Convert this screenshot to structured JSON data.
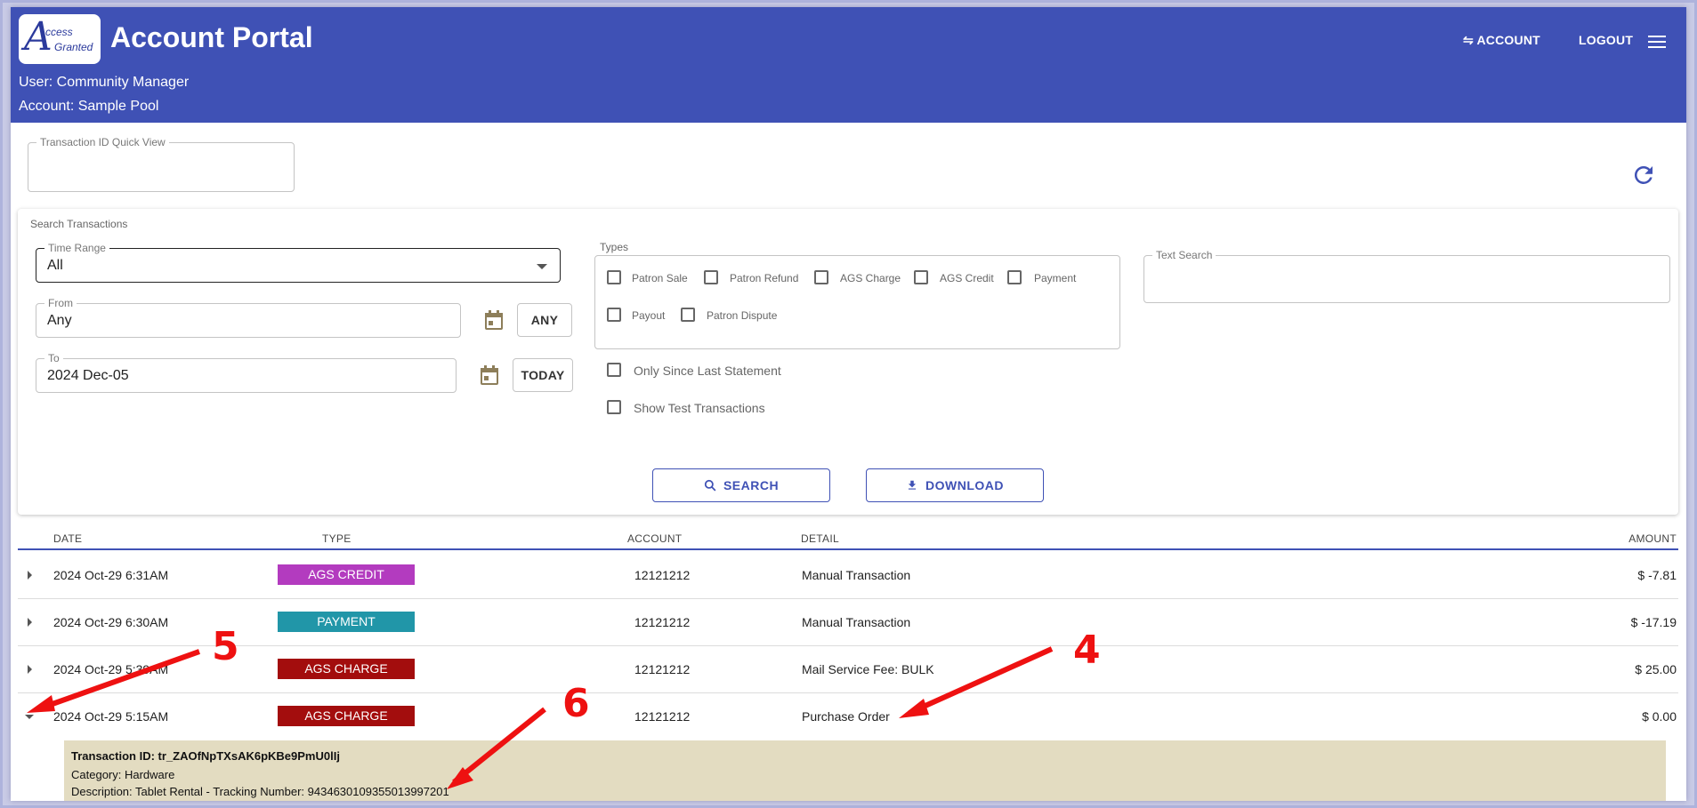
{
  "header": {
    "logo_letter": "A",
    "logo_line1": "ccess",
    "logo_line2": "Granted",
    "title": "Account Portal",
    "user_line": "User: Community Manager",
    "account_line": "Account: Sample Pool",
    "account_button": "⇋ ACCOUNT",
    "logout_button": "LOGOUT"
  },
  "quick_view": {
    "label": "Transaction ID Quick View",
    "value": ""
  },
  "search": {
    "section_label": "Search Transactions",
    "time_range_label": "Time Range",
    "time_range_value": "All",
    "from_label": "From",
    "from_value": "Any",
    "any_button": "ANY",
    "to_label": "To",
    "to_value": "2024 Dec-05",
    "today_button": "TODAY",
    "types_label": "Types",
    "types": [
      "Patron Sale",
      "Patron Refund",
      "AGS Charge",
      "AGS Credit",
      "Payment",
      "Payout",
      "Patron Dispute"
    ],
    "only_since_label": "Only Since Last Statement",
    "show_test_label": "Show Test Transactions",
    "text_search_label": "Text Search",
    "text_search_value": "",
    "search_button": "SEARCH",
    "download_button": "DOWNLOAD"
  },
  "table": {
    "headers": {
      "date": "DATE",
      "type": "TYPE",
      "account": "ACCOUNT",
      "detail": "DETAIL",
      "amount": "AMOUNT"
    },
    "rows": [
      {
        "date": "2024 Oct-29 6:31AM",
        "type": "AGS CREDIT",
        "type_color": "#b33bbf",
        "account": "12121212",
        "detail": "Manual Transaction",
        "amount": "$ -7.81"
      },
      {
        "date": "2024 Oct-29 6:30AM",
        "type": "PAYMENT",
        "type_color": "#2196a8",
        "account": "12121212",
        "detail": "Manual Transaction",
        "amount": "$ -17.19"
      },
      {
        "date": "2024 Oct-29 5:39AM",
        "type": "AGS CHARGE",
        "type_color": "#a30d0d",
        "account": "12121212",
        "detail": "Mail Service Fee: BULK",
        "amount": "$ 25.00"
      },
      {
        "date": "2024 Oct-29 5:15AM",
        "type": "AGS CHARGE",
        "type_color": "#a30d0d",
        "account": "12121212",
        "detail": "Purchase Order",
        "amount": "$ 0.00"
      }
    ],
    "expanded": {
      "transaction_id": "Transaction ID: tr_ZAOfNpTXsAK6pKBe9PmU0lIj",
      "category": "Category: Hardware",
      "description": "Description: Tablet Rental - Tracking Number: 9434630109355013997201"
    }
  },
  "annotations": {
    "n4": "4",
    "n5": "5",
    "n6": "6"
  },
  "colors": {
    "header_bg": "#3f51b5",
    "accent": "#3f51b5",
    "detail_bg": "#e3dcc1",
    "annotation": "#ee1111"
  }
}
